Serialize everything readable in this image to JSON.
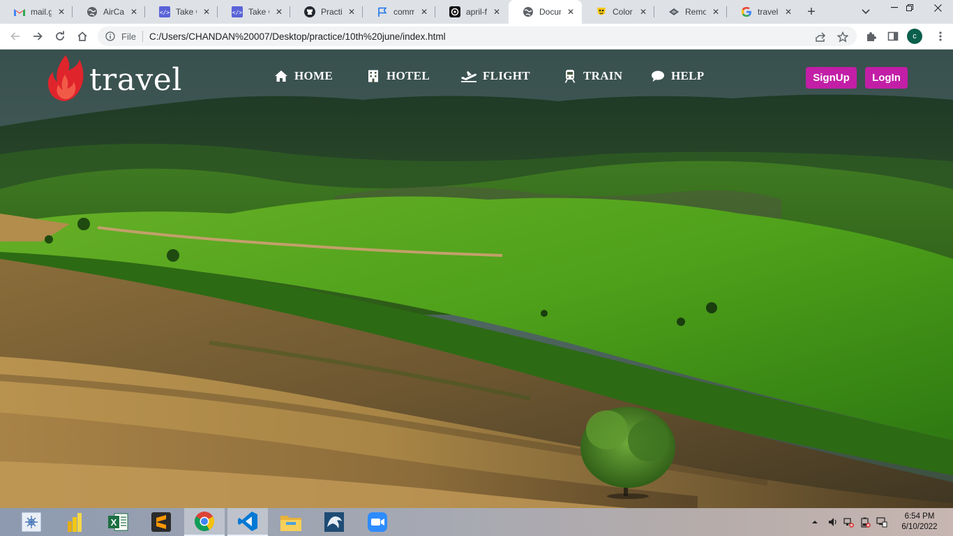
{
  "browser": {
    "tabs": [
      {
        "label": "mail.gc",
        "icon": "gmail-icon"
      },
      {
        "label": "AirCam",
        "icon": "globe-icon"
      },
      {
        "label": "Take Ch",
        "icon": "code-icon"
      },
      {
        "label": "Take Ch",
        "icon": "code-icon"
      },
      {
        "label": "Practice",
        "icon": "github-icon"
      },
      {
        "label": "comme",
        "icon": "flag-icon"
      },
      {
        "label": "april-fu",
        "icon": "openai-icon"
      },
      {
        "label": "Docum",
        "icon": "globe-icon",
        "active": true
      },
      {
        "label": "Color P",
        "icon": "colorpicker-icon"
      },
      {
        "label": "Remov",
        "icon": "remove-bg-icon"
      },
      {
        "label": "travelin",
        "icon": "google-icon"
      }
    ],
    "address": {
      "scheme_label": "File",
      "url": "C:/Users/CHANDAN%20007/Desktop/practice/10th%20june/index.html"
    },
    "profile_initial": "c"
  },
  "site": {
    "logo_text": "travel",
    "nav": [
      {
        "label": "HOME",
        "icon": "home-icon"
      },
      {
        "label": "HOTEL",
        "icon": "hotel-icon"
      },
      {
        "label": "FLIGHT",
        "icon": "plane-icon"
      },
      {
        "label": "TRAIN",
        "icon": "train-icon"
      },
      {
        "label": "HELP",
        "icon": "chat-bubble-icon"
      }
    ],
    "signup_label": "SignUp",
    "login_label": "LogIn",
    "accent_color": "#c21fa6"
  },
  "taskbar": {
    "apps": [
      "snipping-tool-icon",
      "power-bi-icon",
      "excel-icon",
      "sublime-text-icon",
      "chrome-icon",
      "vscode-icon",
      "file-explorer-icon",
      "mysql-workbench-icon",
      "zoom-icon"
    ],
    "time": "6:54 PM",
    "date": "6/10/2022"
  }
}
